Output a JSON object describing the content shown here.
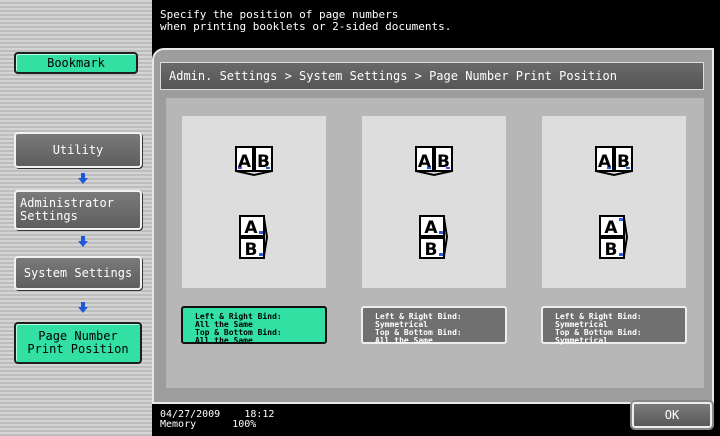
{
  "header": {
    "message_line1": "Specify the position of page numbers",
    "message_line2": "when printing booklets or 2-sided documents."
  },
  "sidebar": {
    "bookmark": "Bookmark",
    "items": [
      {
        "label": "Utility"
      },
      {
        "label_line1": "Administrator",
        "label_line2": "Settings"
      },
      {
        "label": "System Settings"
      },
      {
        "label_line1": "Page Number",
        "label_line2": "Print Position"
      }
    ]
  },
  "breadcrumb": "Admin. Settings > System Settings > Page Number Print Position",
  "options": [
    {
      "label": "Left & Right Bind:\nAll the Same\nTop & Bottom Bind:\nAll the Same",
      "selected": true
    },
    {
      "label": "Left & Right Bind:\nSymmetrical\nTop & Bottom Bind:\nAll the Same",
      "selected": false
    },
    {
      "label": "Left & Right Bind:\nSymmetrical\nTop & Bottom Bind:\nSymmetrical",
      "selected": false
    }
  ],
  "status": {
    "date": "04/27/2009",
    "time": "18:12",
    "memory_label": "Memory",
    "memory_value": "100%"
  },
  "ok_label": "OK",
  "colors": {
    "accent_green": "#33e0a4",
    "arrow_blue": "#1f58d8",
    "page_number_blue": "#2f5fe0"
  }
}
